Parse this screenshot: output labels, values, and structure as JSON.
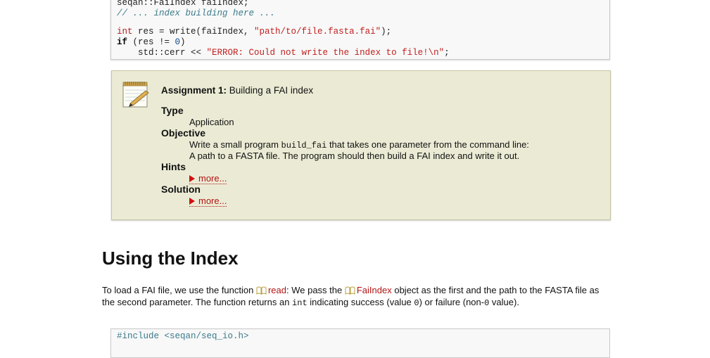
{
  "code_top": {
    "line1": "seqan::FaiIndex faiIndex;",
    "line2": "// ... index building here ...",
    "line3_kw": "int",
    "line3_rest_a": " res = write(faiIndex, ",
    "line3_str": "\"path/to/file.fasta.fai\"",
    "line3_rest_b": ");",
    "line4_kw": "if",
    "line4_rest_a": " (res != ",
    "line4_num": "0",
    "line4_rest_b": ")",
    "line5_a": "    std::cerr << ",
    "line5_str": "\"ERROR: Could not write the index to file!\\n\"",
    "line5_b": ";"
  },
  "assignment": {
    "title_bold": "Assignment 1:",
    "title_rest": " Building a FAI index",
    "type_term": "Type",
    "type_value": "Application",
    "objective_term": "Objective",
    "objective_a": "Write a small program ",
    "objective_code": "build_fai",
    "objective_b": " that takes one parameter from the command line:",
    "objective_line2": "A path to a FASTA file. The program should then build a FAI index and write it out.",
    "hints_term": "Hints",
    "hints_more": "more...",
    "solution_term": "Solution",
    "solution_more": "more..."
  },
  "section": {
    "heading": "Using the Index",
    "p_a": "To load a FAI file, we use the function ",
    "p_link1": "read",
    "p_b": ": We pass the ",
    "p_link2": "FaiIndex",
    "p_c": " object as the first and the path to the FASTA file as the second parameter. The function returns an ",
    "p_code1": "int",
    "p_d": " indicating success (value ",
    "p_code2": "0",
    "p_e": ") or failure (non-",
    "p_code3": "0",
    "p_f": " value)."
  },
  "code_bottom": {
    "line1": "#include <seqan/seq_io.h>"
  },
  "colors": {
    "link": "#b31414",
    "assignment_bg": "#ebebd5",
    "code_bg": "#f8f8f8"
  }
}
